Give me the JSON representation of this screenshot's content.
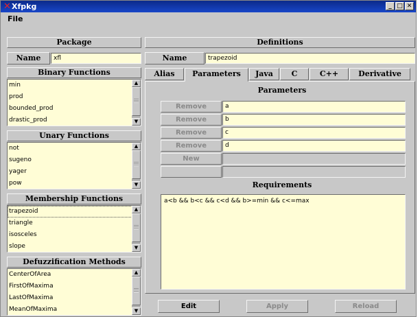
{
  "window": {
    "title": "Xfpkg",
    "controls": [
      "_",
      "□",
      "✕"
    ]
  },
  "menu": {
    "file": "File"
  },
  "package": {
    "header": "Package",
    "name_label": "Name",
    "name_value": "xfl"
  },
  "binary": {
    "header": "Binary Functions",
    "items": [
      "min",
      "prod",
      "bounded_prod",
      "drastic_prod"
    ]
  },
  "unary": {
    "header": "Unary Functions",
    "items": [
      "not",
      "sugeno",
      "yager",
      "pow"
    ]
  },
  "membership": {
    "header": "Membership Functions",
    "items": [
      "trapezoid",
      "triangle",
      "isosceles",
      "slope"
    ],
    "selected": 0
  },
  "defuzz": {
    "header": "Defuzzification Methods",
    "items": [
      "CenterOfArea",
      "FirstOfMaxima",
      "LastOfMaxima",
      "MeanOfMaxima"
    ]
  },
  "definitions": {
    "header": "Definitions",
    "name_label": "Name",
    "name_value": "trapezoid",
    "tabs": [
      "Alias",
      "Parameters",
      "Java",
      "C",
      "C++",
      "Derivative"
    ],
    "active_tab": 1
  },
  "parameters": {
    "header": "Parameters",
    "remove_label": "Remove",
    "new_label": "New",
    "values": [
      "a",
      "b",
      "c",
      "d"
    ]
  },
  "requirements": {
    "header": "Requirements",
    "text": "a<b && b<c && c<d && b>=min && c<=max"
  },
  "buttons": {
    "edit": "Edit",
    "apply": "Apply",
    "reload": "Reload"
  },
  "colors": {
    "field_bg": "#fffdd6",
    "panel_bg": "#c8c8c8",
    "titlebar": "#1846c8",
    "disabled_text": "#8a8a8a"
  }
}
